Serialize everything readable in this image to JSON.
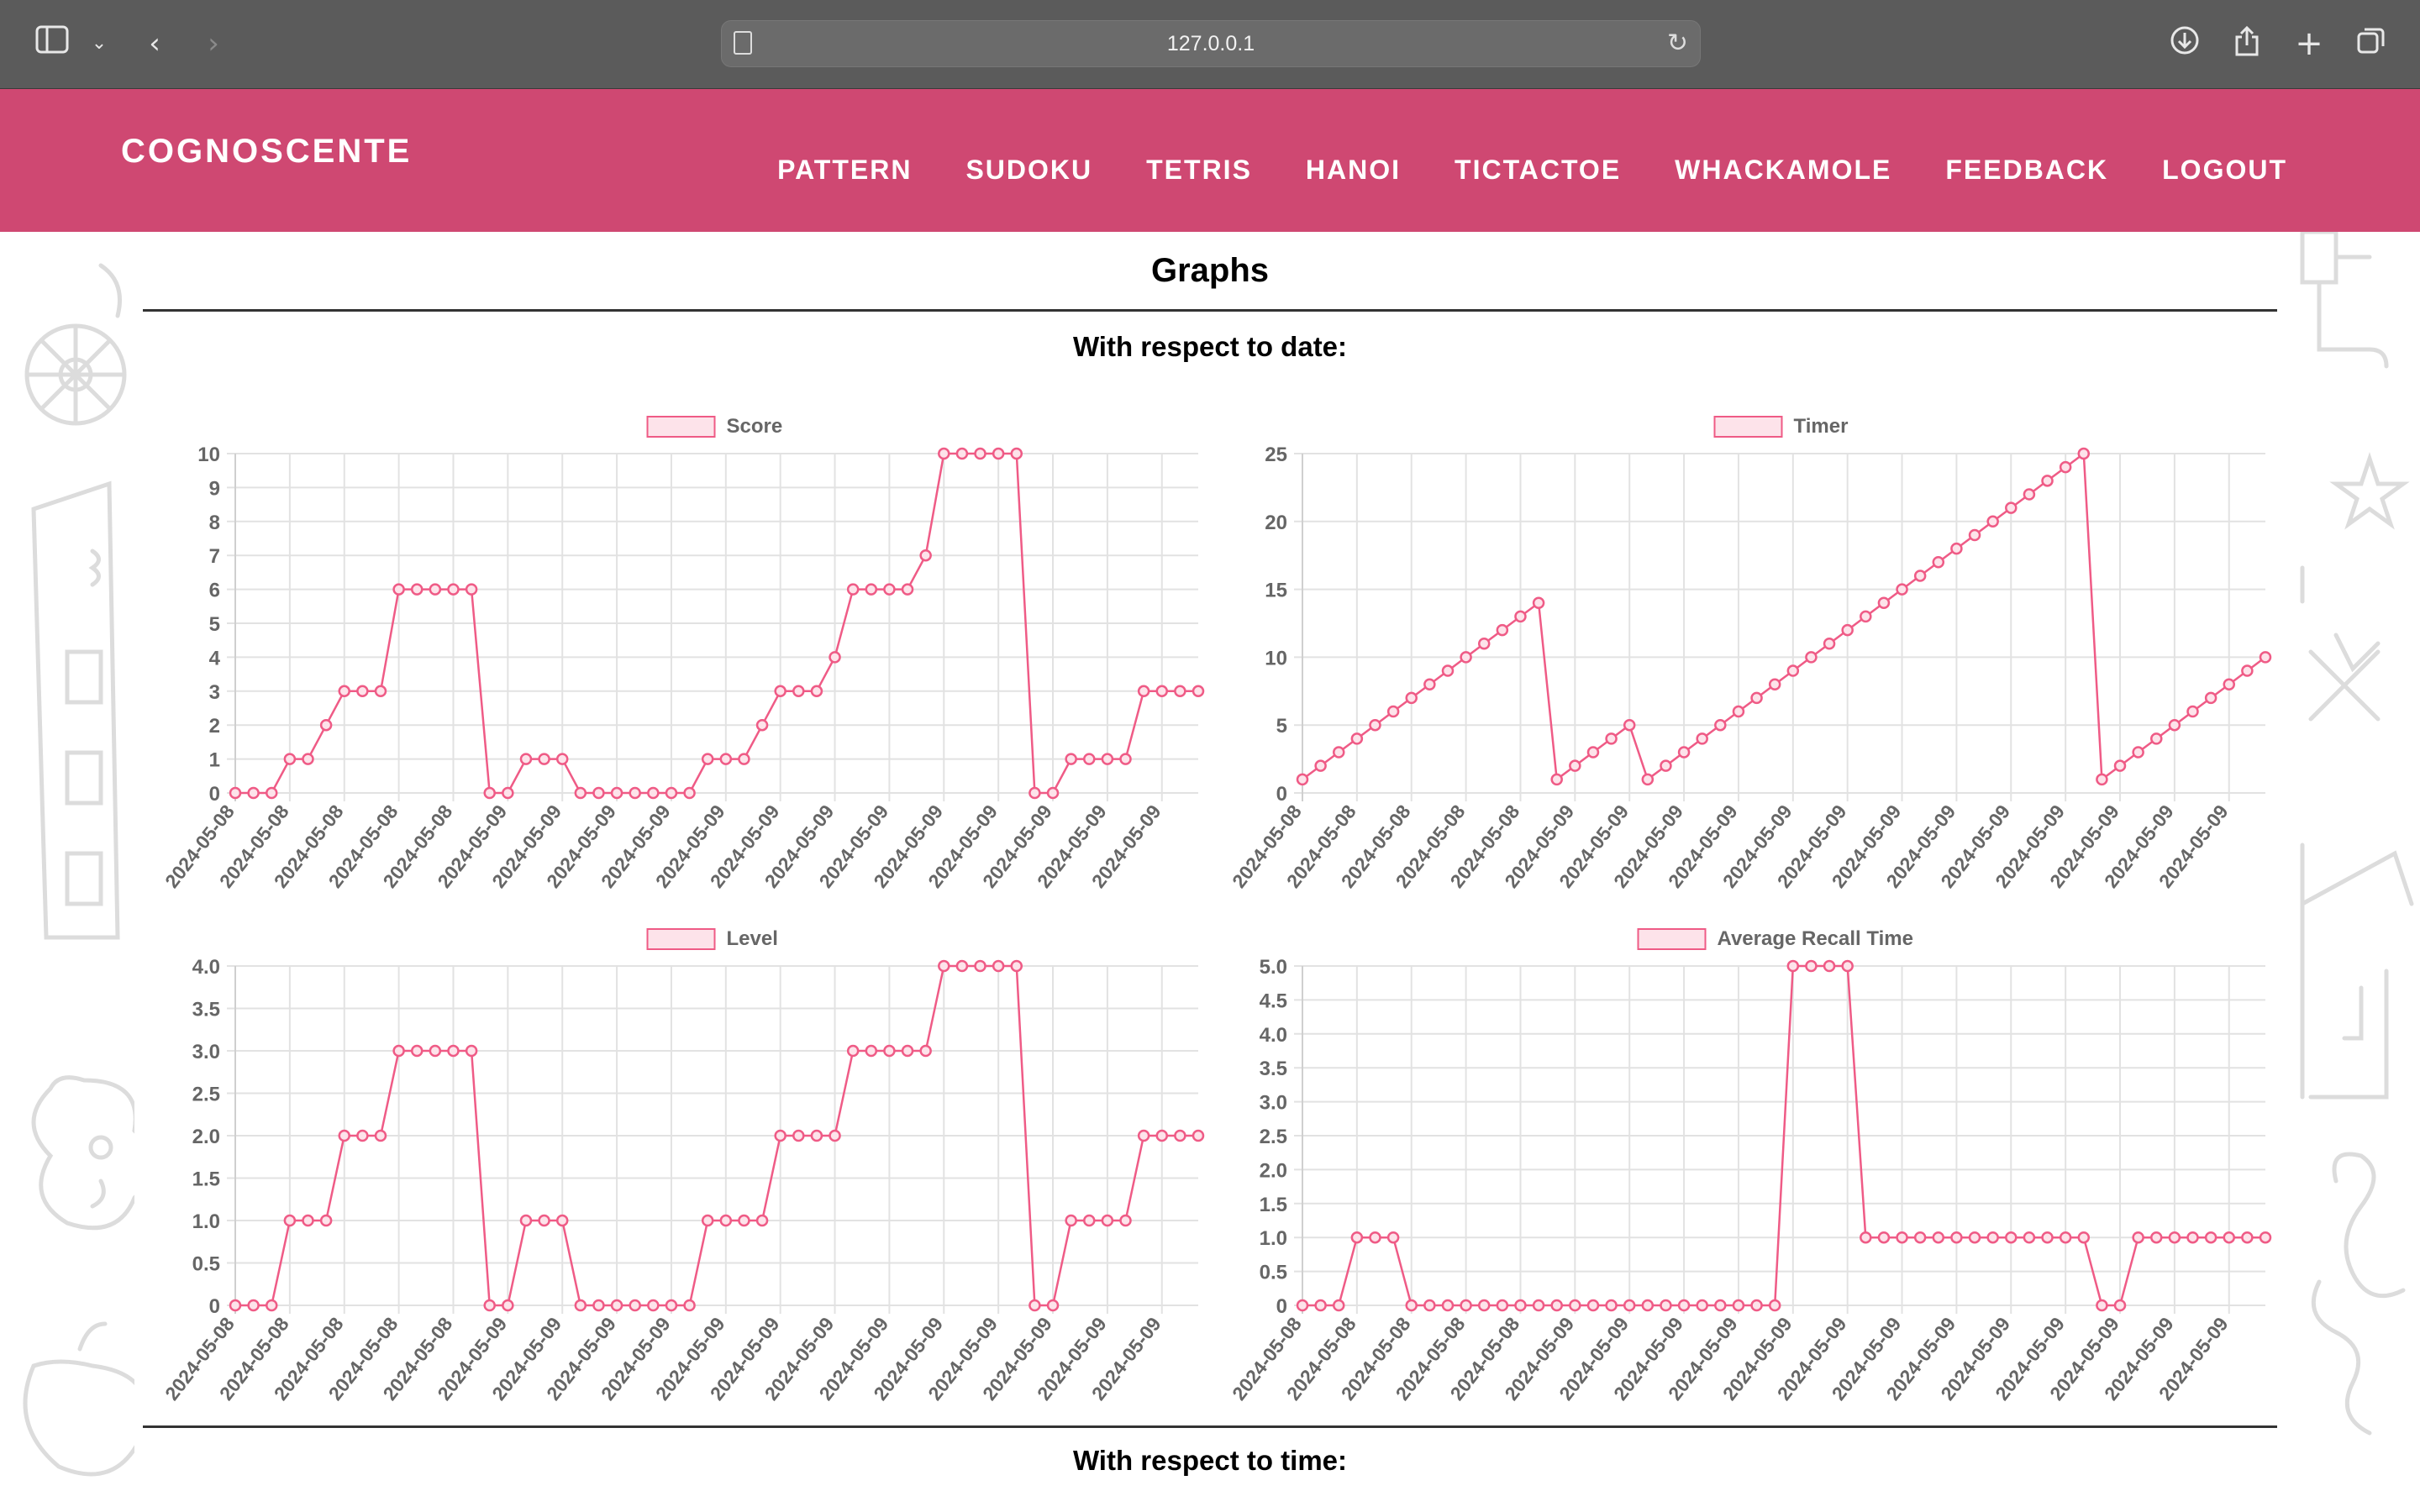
{
  "browser": {
    "url": "127.0.0.1"
  },
  "site": {
    "brand": "COGNOSCENTE",
    "nav": [
      "PATTERN",
      "SUDOKU",
      "TETRIS",
      "HANOI",
      "TICTACTOE",
      "WHACKAMOLE",
      "FEEDBACK",
      "LOGOUT"
    ]
  },
  "page": {
    "title": "Graphs",
    "section_date": "With respect to date:",
    "section_time": "With respect to time:"
  },
  "colors": {
    "header": "#cf4872",
    "line": "#ef5b86",
    "fill": "#fde3ea"
  },
  "chart_data": [
    {
      "type": "line",
      "legend": "Score",
      "xtick_labels": [
        "2024-05-08",
        "2024-05-08",
        "2024-05-08",
        "2024-05-08",
        "2024-05-08",
        "2024-05-09",
        "2024-05-09",
        "2024-05-09",
        "2024-05-09",
        "2024-05-09",
        "2024-05-09",
        "2024-05-09",
        "2024-05-09",
        "2024-05-09",
        "2024-05-09",
        "2024-05-09",
        "2024-05-09",
        "2024-05-09"
      ],
      "values": [
        0,
        0,
        0,
        1,
        1,
        2,
        3,
        3,
        3,
        6,
        6,
        6,
        6,
        6,
        0,
        0,
        1,
        1,
        1,
        0,
        0,
        0,
        0,
        0,
        0,
        0,
        1,
        1,
        1,
        2,
        3,
        3,
        3,
        4,
        6,
        6,
        6,
        6,
        7,
        10,
        10,
        10,
        10,
        10,
        0,
        0,
        1,
        1,
        1,
        1,
        3,
        3,
        3,
        3
      ],
      "ylim": [
        0,
        10
      ],
      "yticks": [
        0,
        1,
        2,
        3,
        4,
        5,
        6,
        7,
        8,
        9,
        10
      ]
    },
    {
      "type": "line",
      "legend": "Timer",
      "xtick_labels": [
        "2024-05-08",
        "2024-05-08",
        "2024-05-08",
        "2024-05-08",
        "2024-05-08",
        "2024-05-09",
        "2024-05-09",
        "2024-05-09",
        "2024-05-09",
        "2024-05-09",
        "2024-05-09",
        "2024-05-09",
        "2024-05-09",
        "2024-05-09",
        "2024-05-09",
        "2024-05-09",
        "2024-05-09",
        "2024-05-09"
      ],
      "values": [
        1,
        2,
        3,
        4,
        5,
        6,
        7,
        8,
        9,
        10,
        11,
        12,
        13,
        14,
        1,
        2,
        3,
        4,
        5,
        1,
        2,
        3,
        4,
        5,
        6,
        7,
        8,
        9,
        10,
        11,
        12,
        13,
        14,
        15,
        16,
        17,
        18,
        19,
        20,
        21,
        22,
        23,
        24,
        25,
        1,
        2,
        3,
        4,
        5,
        6,
        7,
        8,
        9,
        10
      ],
      "ylim": [
        0,
        25
      ],
      "yticks": [
        0,
        5,
        10,
        15,
        20,
        25
      ]
    },
    {
      "type": "line",
      "legend": "Level",
      "xtick_labels": [
        "2024-05-08",
        "2024-05-08",
        "2024-05-08",
        "2024-05-08",
        "2024-05-08",
        "2024-05-09",
        "2024-05-09",
        "2024-05-09",
        "2024-05-09",
        "2024-05-09",
        "2024-05-09",
        "2024-05-09",
        "2024-05-09",
        "2024-05-09",
        "2024-05-09",
        "2024-05-09",
        "2024-05-09",
        "2024-05-09"
      ],
      "values": [
        0,
        0,
        0,
        1,
        1,
        1,
        2,
        2,
        2,
        3,
        3,
        3,
        3,
        3,
        0,
        0,
        1,
        1,
        1,
        0,
        0,
        0,
        0,
        0,
        0,
        0,
        1,
        1,
        1,
        1,
        2,
        2,
        2,
        2,
        3,
        3,
        3,
        3,
        3,
        4,
        4,
        4,
        4,
        4,
        0,
        0,
        1,
        1,
        1,
        1,
        2,
        2,
        2,
        2
      ],
      "ylim": [
        0,
        4
      ],
      "yticks": [
        "0",
        "0.5",
        "1.0",
        "1.5",
        "2.0",
        "2.5",
        "3.0",
        "3.5",
        "4.0"
      ]
    },
    {
      "type": "line",
      "legend": "Average Recall Time",
      "xtick_labels": [
        "2024-05-08",
        "2024-05-08",
        "2024-05-08",
        "2024-05-08",
        "2024-05-08",
        "2024-05-09",
        "2024-05-09",
        "2024-05-09",
        "2024-05-09",
        "2024-05-09",
        "2024-05-09",
        "2024-05-09",
        "2024-05-09",
        "2024-05-09",
        "2024-05-09",
        "2024-05-09",
        "2024-05-09",
        "2024-05-09"
      ],
      "values": [
        0,
        0,
        0,
        1,
        1,
        1,
        0,
        0,
        0,
        0,
        0,
        0,
        0,
        0,
        0,
        0,
        0,
        0,
        0,
        0,
        0,
        0,
        0,
        0,
        0,
        0,
        0,
        5,
        5,
        5,
        5,
        1,
        1,
        1,
        1,
        1,
        1,
        1,
        1,
        1,
        1,
        1,
        1,
        1,
        0,
        0,
        1,
        1,
        1,
        1,
        1,
        1,
        1,
        1
      ],
      "ylim": [
        0,
        5
      ],
      "yticks": [
        "0",
        "0.5",
        "1.0",
        "1.5",
        "2.0",
        "2.5",
        "3.0",
        "3.5",
        "4.0",
        "4.5",
        "5.0"
      ]
    }
  ]
}
